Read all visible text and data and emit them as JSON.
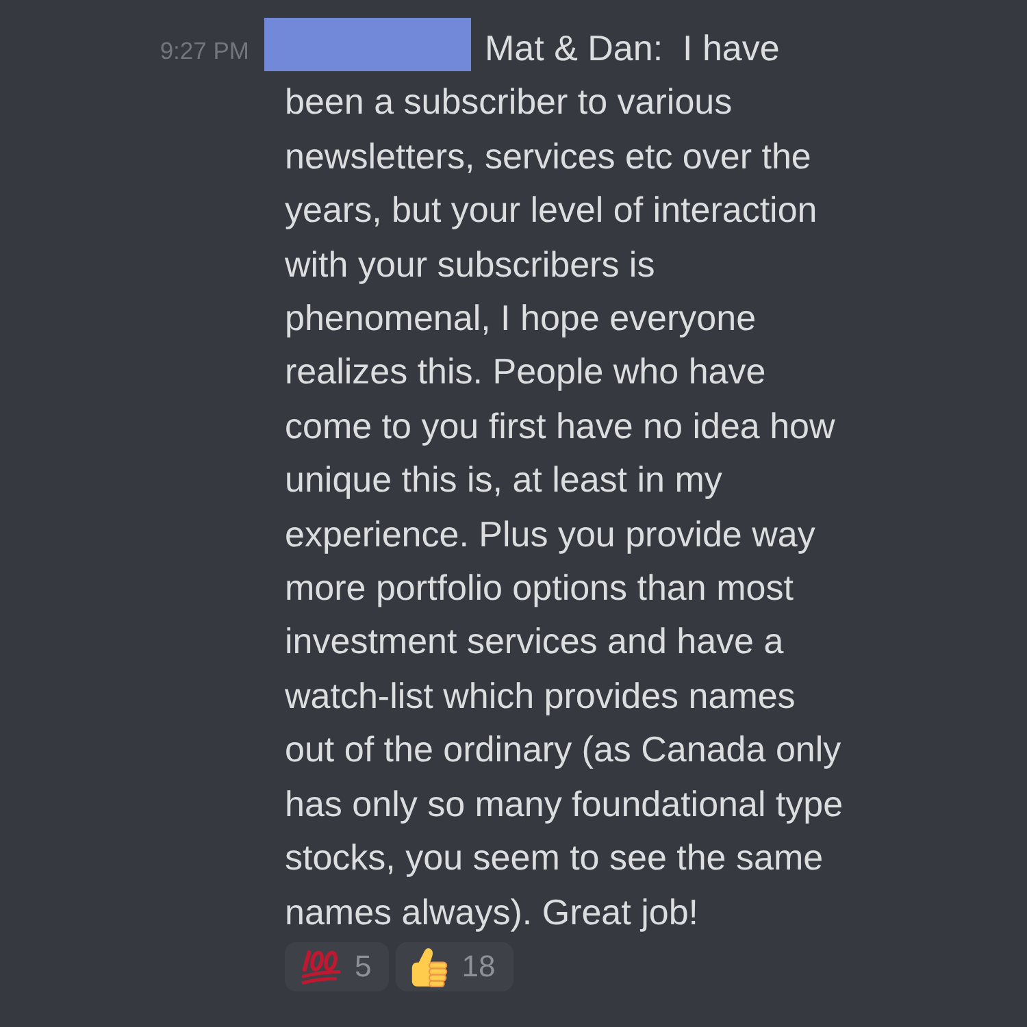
{
  "message": {
    "timestamp": "9:27 PM",
    "first_line": "Mat & Dan:  I have",
    "continuation": "been a subscriber to various\nnewsletters, services etc over the\nyears, but your level of interaction\nwith your subscribers is\nphenomenal, I hope everyone\nrealizes this. People who have\ncome to you first have no idea how\nunique this is, at least in my\nexperience. Plus you provide way\nmore portfolio options than most\ninvestment services and have a\nwatch-list which provides names\nout of the ordinary (as Canada only\nhas only so many foundational type\nstocks, you seem to see the same\nnames always). Great job!"
  },
  "reactions": [
    {
      "kind": "hundred",
      "count": "5",
      "selected": false
    },
    {
      "kind": "thumbs_up",
      "count": "18",
      "selected": false
    }
  ]
}
